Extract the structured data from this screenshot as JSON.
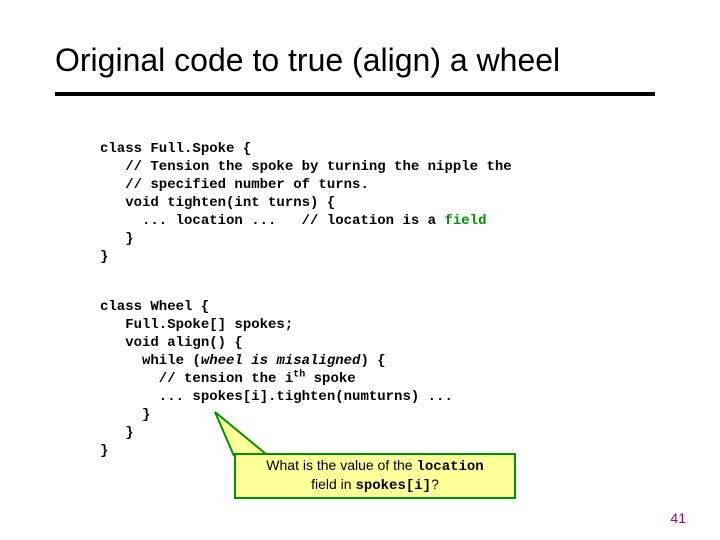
{
  "title": "Original code to true (align) a wheel",
  "code1": {
    "l1": "class Full.Spoke {",
    "l2": "   // Tension the spoke by turning the nipple the",
    "l3": "   // specified number of turns.",
    "l4": "   void tighten(int turns) {",
    "l5a": "     ... location ...   // location is a ",
    "l5b": "field",
    "l6": "   }",
    "l7": "}"
  },
  "code2": {
    "l1": "class Wheel {",
    "l2": "   Full.Spoke[] spokes;",
    "l3": "   void align() {",
    "l4a": "     while (",
    "l4b": "wheel is misaligned",
    "l4c": ") {",
    "l5a": "       // tension the i",
    "l5b": "th",
    "l5c": " spoke",
    "l6": "       ... spokes[i].tighten(numturns) ...",
    "l7": "     }",
    "l8": "   }",
    "l9": "}"
  },
  "callout": {
    "t1": "What is the value of the ",
    "t2": "location",
    "t3": "field in ",
    "t4": "spokes[i]",
    "t5": "?"
  },
  "tail_fill": "#ffff99",
  "tail_stroke": "#009000",
  "slide_no": "41"
}
